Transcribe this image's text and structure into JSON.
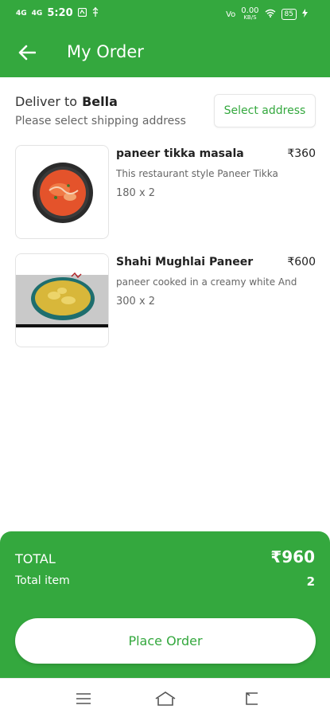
{
  "status_bar": {
    "left_badges": [
      "4G",
      "4G"
    ],
    "time": "5:20",
    "speed_value": "0.00",
    "speed_unit": "KB/S",
    "network": "Vo",
    "battery": "85"
  },
  "header": {
    "title": "My Order",
    "back_icon": "arrow-left-icon"
  },
  "delivery": {
    "label": "Deliver to",
    "name": "Bella",
    "hint": "Please select shipping address",
    "select_button": "Select address"
  },
  "items": [
    {
      "name": "paneer tikka masala",
      "price": "₹360",
      "description": "This restaurant style Paneer Tikka",
      "quantity": "180 x 2"
    },
    {
      "name": "Shahi Mughlai Paneer",
      "price": "₹600",
      "description": "paneer cooked in a creamy white And",
      "quantity": "300 x 2"
    }
  ],
  "summary": {
    "total_label": "TOTAL",
    "total_value": "₹960",
    "item_label": "Total item",
    "item_count": "2",
    "place_order": "Place Order"
  },
  "navigation": {
    "icons": [
      "menu-icon",
      "home-icon",
      "back-icon"
    ]
  },
  "colors": {
    "primary": "#34a83e",
    "background": "#ffffff",
    "text": "#222222",
    "muted": "#666666"
  }
}
